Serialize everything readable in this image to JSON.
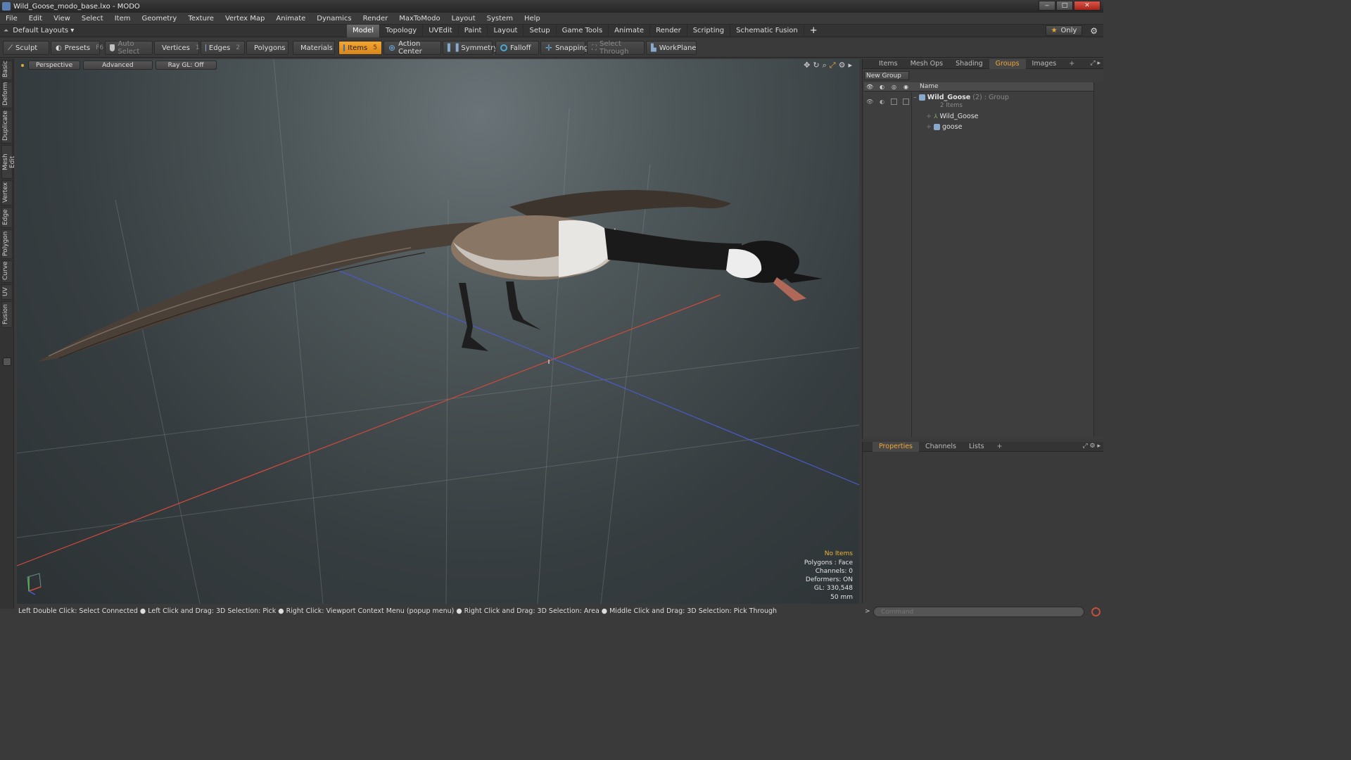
{
  "window": {
    "title": "Wild_Goose_modo_base.lxo - MODO",
    "min": "‒",
    "max": "□",
    "close": "✕"
  },
  "menu": [
    "File",
    "Edit",
    "View",
    "Select",
    "Item",
    "Geometry",
    "Texture",
    "Vertex Map",
    "Animate",
    "Dynamics",
    "Render",
    "MaxToModo",
    "Layout",
    "System",
    "Help"
  ],
  "layoutbar": {
    "layout_name": "Default Layouts ▾",
    "tabs": [
      "Model",
      "Topology",
      "UVEdit",
      "Paint",
      "Layout",
      "Setup",
      "Game Tools",
      "Animate",
      "Render",
      "Scripting",
      "Schematic Fusion"
    ],
    "active_tab": "Model",
    "plus": "+",
    "only_label": "Only"
  },
  "toolbar": {
    "sculpt": "Sculpt",
    "presets": "Presets",
    "presets_key": "F6",
    "auto_select": "Auto Select",
    "vertices": "Vertices",
    "vertices_key": "1",
    "edges": "Edges",
    "edges_key": "2",
    "polygons": "Polygons",
    "materials": "Materials",
    "items": "Items",
    "items_key": "5",
    "action_center": "Action Center",
    "symmetry": "Symmetry",
    "falloff": "Falloff",
    "snapping": "Snapping",
    "select_through": "Select Through",
    "workplane": "WorkPlane"
  },
  "left_tabs": [
    "Basic",
    "Deform",
    "Duplicate",
    "Mesh Edit",
    "Vertex",
    "Edge",
    "Polygon",
    "Curve",
    "UV",
    "Fusion"
  ],
  "viewport": {
    "view": "Perspective",
    "mode": "Advanced",
    "raygl": "Ray GL: Off",
    "info": {
      "items": "No Items",
      "polygons": "Polygons : Face",
      "channels": "Channels: 0",
      "deformers": "Deformers: ON",
      "gl": "GL: 330,548",
      "size": "50 mm"
    },
    "colors": {
      "x_axis": "#d04a3c",
      "z_axis": "#4a5ccc",
      "accent": "#f0a634"
    }
  },
  "groups_panel": {
    "tabs": [
      "Items",
      "Mesh Ops",
      "Shading",
      "Groups",
      "Images"
    ],
    "active_tab": "Groups",
    "plus": "+",
    "new_group": "New Group",
    "name_header": "Name",
    "rows": [
      {
        "name": "Wild_Goose",
        "count": "(2)",
        "type": ": Group",
        "sub": "2 Items"
      },
      {
        "name": "Wild_Goose"
      },
      {
        "name": "goose"
      }
    ]
  },
  "props_panel": {
    "tabs": [
      "Properties",
      "Channels",
      "Lists"
    ],
    "active_tab": "Properties",
    "plus": "+"
  },
  "status": "Left Double Click: Select Connected ● Left Click and Drag: 3D Selection: Pick ● Right Click: Viewport Context Menu (popup menu) ● Right Click and Drag: 3D Selection: Area ● Middle Click and Drag: 3D Selection: Pick Through",
  "command": {
    "placeholder": "Command"
  }
}
